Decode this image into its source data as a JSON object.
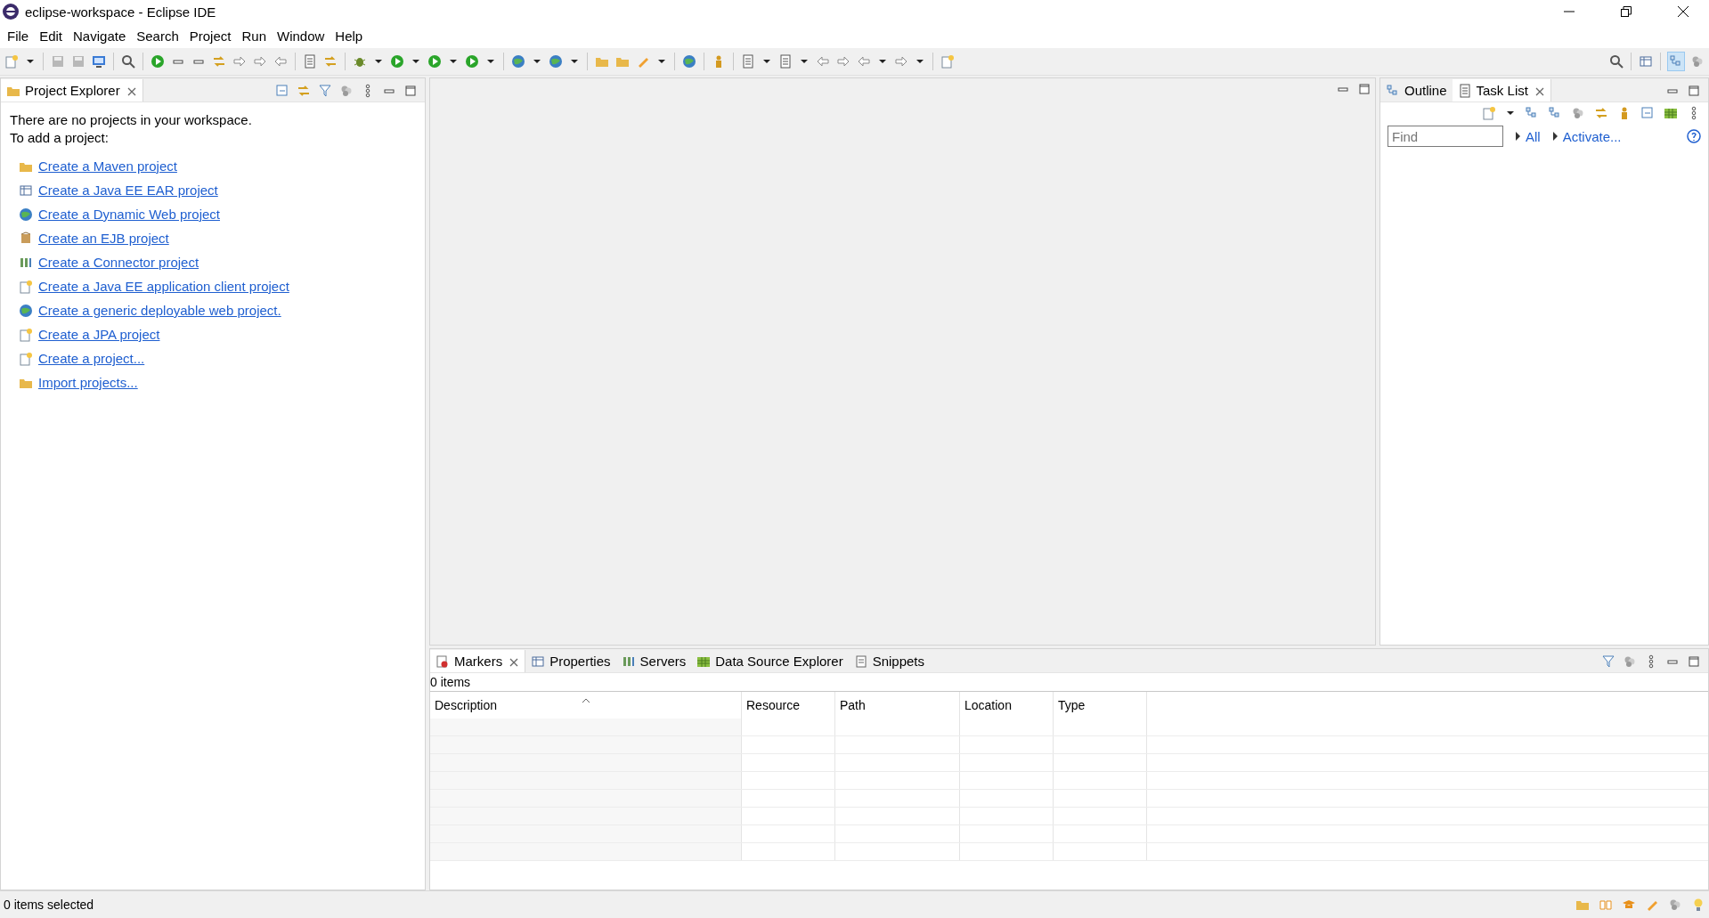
{
  "window": {
    "title": "eclipse-workspace - Eclipse IDE"
  },
  "menu": [
    "File",
    "Edit",
    "Navigate",
    "Search",
    "Project",
    "Run",
    "Window",
    "Help"
  ],
  "project_explorer": {
    "tab": {
      "label": "Project Explorer",
      "selected": true
    },
    "message": [
      "There are no projects in your workspace.",
      "To add a project:"
    ],
    "links": [
      "Create a Maven project",
      "Create a Java EE EAR project",
      "Create a Dynamic Web project",
      "Create an EJB project",
      "Create a Connector project",
      "Create a Java EE application client project",
      "Create a generic deployable web project.",
      "Create a JPA project",
      "Create a project...",
      "Import projects..."
    ]
  },
  "right_panel": {
    "tabs": [
      {
        "label": "Outline",
        "selected": false
      },
      {
        "label": "Task List",
        "selected": true
      }
    ],
    "find": {
      "placeholder": "Find"
    },
    "links": [
      "All",
      "Activate..."
    ]
  },
  "bottom_panel": {
    "tabs": [
      {
        "label": "Markers",
        "selected": true
      },
      {
        "label": "Properties",
        "selected": false
      },
      {
        "label": "Servers",
        "selected": false
      },
      {
        "label": "Data Source Explorer",
        "selected": false
      },
      {
        "label": "Snippets",
        "selected": false
      }
    ],
    "summary": "0 items",
    "columns": [
      "Description",
      "Resource",
      "Path",
      "Location",
      "Type"
    ]
  },
  "status_bar": {
    "text": "0 items selected"
  }
}
